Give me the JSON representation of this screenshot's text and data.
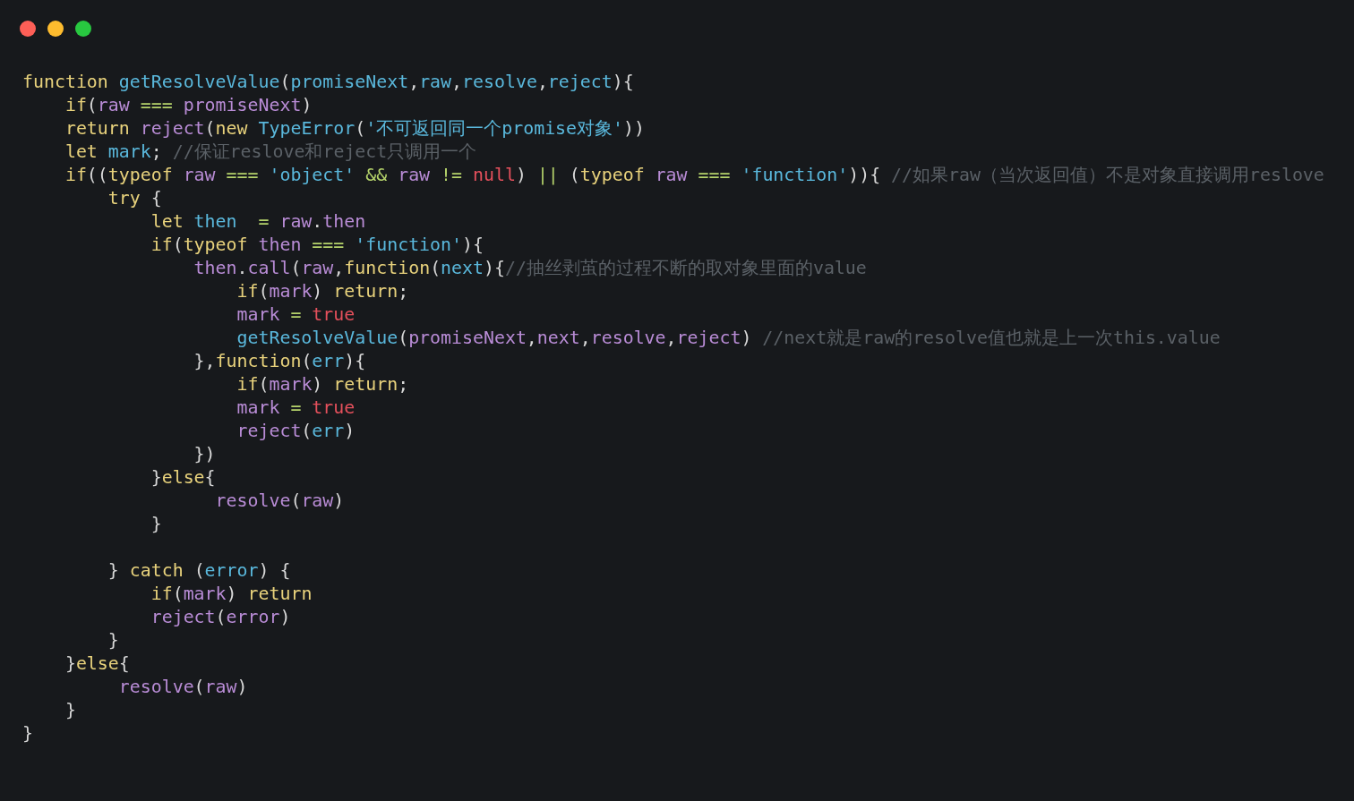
{
  "code_lines": [
    {
      "kind": "code",
      "tokens": [
        {
          "text": "function ",
          "kind": "kw"
        },
        {
          "text": "getResolveValue",
          "kind": "fn"
        },
        {
          "text": "(",
          "kind": "p"
        },
        {
          "text": "promiseNext",
          "kind": "fn"
        },
        {
          "text": ",",
          "kind": "p"
        },
        {
          "text": "raw",
          "kind": "fn"
        },
        {
          "text": ",",
          "kind": "p"
        },
        {
          "text": "resolve",
          "kind": "fn"
        },
        {
          "text": ",",
          "kind": "p"
        },
        {
          "text": "reject",
          "kind": "fn"
        },
        {
          "text": "){",
          "kind": "p"
        }
      ]
    },
    {
      "kind": "code",
      "tokens": [
        {
          "text": "    if",
          "kind": "kw"
        },
        {
          "text": "(",
          "kind": "p"
        },
        {
          "text": "raw ",
          "kind": "v"
        },
        {
          "text": "=== ",
          "kind": "op"
        },
        {
          "text": "promiseNext",
          "kind": "v"
        },
        {
          "text": ")",
          "kind": "p"
        }
      ]
    },
    {
      "kind": "code",
      "tokens": [
        {
          "text": "    return ",
          "kind": "kw"
        },
        {
          "text": "reject",
          "kind": "v"
        },
        {
          "text": "(",
          "kind": "p"
        },
        {
          "text": "new ",
          "kind": "kw"
        },
        {
          "text": "TypeError",
          "kind": "fn"
        },
        {
          "text": "(",
          "kind": "p"
        },
        {
          "text": "'不可返回同一个promise对象'",
          "kind": "str"
        },
        {
          "text": "))",
          "kind": "p"
        }
      ]
    },
    {
      "kind": "code",
      "tokens": [
        {
          "text": "    let ",
          "kind": "kw"
        },
        {
          "text": "mark",
          "kind": "fn"
        },
        {
          "text": "; ",
          "kind": "p"
        },
        {
          "text": "//保证reslove和reject只调用一个",
          "kind": "cm"
        }
      ]
    },
    {
      "kind": "code",
      "tokens": [
        {
          "text": "    if",
          "kind": "kw"
        },
        {
          "text": "((",
          "kind": "p"
        },
        {
          "text": "typeof ",
          "kind": "kw"
        },
        {
          "text": "raw ",
          "kind": "v"
        },
        {
          "text": "=== ",
          "kind": "op"
        },
        {
          "text": "'object' ",
          "kind": "str"
        },
        {
          "text": "&& ",
          "kind": "op"
        },
        {
          "text": "raw ",
          "kind": "v"
        },
        {
          "text": "!= ",
          "kind": "op"
        },
        {
          "text": "null",
          "kind": "lit"
        },
        {
          "text": ") ",
          "kind": "p"
        },
        {
          "text": "|| ",
          "kind": "op"
        },
        {
          "text": "(",
          "kind": "p"
        },
        {
          "text": "typeof ",
          "kind": "kw"
        },
        {
          "text": "raw ",
          "kind": "v"
        },
        {
          "text": "=== ",
          "kind": "op"
        },
        {
          "text": "'function'",
          "kind": "str"
        },
        {
          "text": ")){ ",
          "kind": "p"
        },
        {
          "text": "//如果raw（当次返回值）不是对象直接调用reslove",
          "kind": "cm"
        }
      ]
    },
    {
      "kind": "code",
      "tokens": [
        {
          "text": "        try ",
          "kind": "kw"
        },
        {
          "text": "{",
          "kind": "p"
        }
      ]
    },
    {
      "kind": "code",
      "tokens": [
        {
          "text": "            let ",
          "kind": "kw"
        },
        {
          "text": "then  ",
          "kind": "fn"
        },
        {
          "text": "= ",
          "kind": "op"
        },
        {
          "text": "raw",
          "kind": "v"
        },
        {
          "text": ".",
          "kind": "p"
        },
        {
          "text": "then",
          "kind": "v"
        }
      ]
    },
    {
      "kind": "code",
      "tokens": [
        {
          "text": "            if",
          "kind": "kw"
        },
        {
          "text": "(",
          "kind": "p"
        },
        {
          "text": "typeof ",
          "kind": "kw"
        },
        {
          "text": "then ",
          "kind": "v"
        },
        {
          "text": "=== ",
          "kind": "op"
        },
        {
          "text": "'function'",
          "kind": "str"
        },
        {
          "text": "){",
          "kind": "p"
        }
      ]
    },
    {
      "kind": "code",
      "tokens": [
        {
          "text": "                then",
          "kind": "v"
        },
        {
          "text": ".",
          "kind": "p"
        },
        {
          "text": "call",
          "kind": "v"
        },
        {
          "text": "(",
          "kind": "p"
        },
        {
          "text": "raw",
          "kind": "v"
        },
        {
          "text": ",",
          "kind": "p"
        },
        {
          "text": "function",
          "kind": "kw"
        },
        {
          "text": "(",
          "kind": "p"
        },
        {
          "text": "next",
          "kind": "fn"
        },
        {
          "text": "){",
          "kind": "p"
        },
        {
          "text": "//抽丝剥茧的过程不断的取对象里面的value",
          "kind": "cm"
        }
      ]
    },
    {
      "kind": "code",
      "tokens": [
        {
          "text": "                    if",
          "kind": "kw"
        },
        {
          "text": "(",
          "kind": "p"
        },
        {
          "text": "mark",
          "kind": "v"
        },
        {
          "text": ") ",
          "kind": "p"
        },
        {
          "text": "return",
          "kind": "kw"
        },
        {
          "text": ";",
          "kind": "p"
        }
      ]
    },
    {
      "kind": "code",
      "tokens": [
        {
          "text": "                    mark ",
          "kind": "v"
        },
        {
          "text": "= ",
          "kind": "op"
        },
        {
          "text": "true",
          "kind": "lit"
        }
      ]
    },
    {
      "kind": "code",
      "tokens": [
        {
          "text": "                    getResolveValue",
          "kind": "fn"
        },
        {
          "text": "(",
          "kind": "p"
        },
        {
          "text": "promiseNext",
          "kind": "v"
        },
        {
          "text": ",",
          "kind": "p"
        },
        {
          "text": "next",
          "kind": "v"
        },
        {
          "text": ",",
          "kind": "p"
        },
        {
          "text": "resolve",
          "kind": "v"
        },
        {
          "text": ",",
          "kind": "p"
        },
        {
          "text": "reject",
          "kind": "v"
        },
        {
          "text": ") ",
          "kind": "p"
        },
        {
          "text": "//next就是raw的resolve值也就是上一次this.value",
          "kind": "cm"
        }
      ]
    },
    {
      "kind": "code",
      "tokens": [
        {
          "text": "                },",
          "kind": "p"
        },
        {
          "text": "function",
          "kind": "kw"
        },
        {
          "text": "(",
          "kind": "p"
        },
        {
          "text": "err",
          "kind": "fn"
        },
        {
          "text": "){",
          "kind": "p"
        }
      ]
    },
    {
      "kind": "code",
      "tokens": [
        {
          "text": "                    if",
          "kind": "kw"
        },
        {
          "text": "(",
          "kind": "p"
        },
        {
          "text": "mark",
          "kind": "v"
        },
        {
          "text": ") ",
          "kind": "p"
        },
        {
          "text": "return",
          "kind": "kw"
        },
        {
          "text": ";",
          "kind": "p"
        }
      ]
    },
    {
      "kind": "code",
      "tokens": [
        {
          "text": "                    mark ",
          "kind": "v"
        },
        {
          "text": "= ",
          "kind": "op"
        },
        {
          "text": "true",
          "kind": "lit"
        }
      ]
    },
    {
      "kind": "code",
      "tokens": [
        {
          "text": "                    reject",
          "kind": "v"
        },
        {
          "text": "(",
          "kind": "p"
        },
        {
          "text": "err",
          "kind": "fn"
        },
        {
          "text": ")",
          "kind": "p"
        }
      ]
    },
    {
      "kind": "code",
      "tokens": [
        {
          "text": "                })",
          "kind": "p"
        }
      ]
    },
    {
      "kind": "code",
      "tokens": [
        {
          "text": "            }",
          "kind": "p"
        },
        {
          "text": "else",
          "kind": "kw"
        },
        {
          "text": "{",
          "kind": "p"
        }
      ]
    },
    {
      "kind": "code",
      "tokens": [
        {
          "text": "                  resolve",
          "kind": "v"
        },
        {
          "text": "(",
          "kind": "p"
        },
        {
          "text": "raw",
          "kind": "v"
        },
        {
          "text": ")",
          "kind": "p"
        }
      ]
    },
    {
      "kind": "code",
      "tokens": [
        {
          "text": "            }",
          "kind": "p"
        }
      ]
    },
    {
      "kind": "blank"
    },
    {
      "kind": "code",
      "tokens": [
        {
          "text": "        } ",
          "kind": "p"
        },
        {
          "text": "catch ",
          "kind": "kw"
        },
        {
          "text": "(",
          "kind": "p"
        },
        {
          "text": "error",
          "kind": "fn"
        },
        {
          "text": ") {",
          "kind": "p"
        }
      ]
    },
    {
      "kind": "code",
      "tokens": [
        {
          "text": "            if",
          "kind": "kw"
        },
        {
          "text": "(",
          "kind": "p"
        },
        {
          "text": "mark",
          "kind": "v"
        },
        {
          "text": ") ",
          "kind": "p"
        },
        {
          "text": "return",
          "kind": "kw"
        }
      ]
    },
    {
      "kind": "code",
      "tokens": [
        {
          "text": "            reject",
          "kind": "v"
        },
        {
          "text": "(",
          "kind": "p"
        },
        {
          "text": "error",
          "kind": "v"
        },
        {
          "text": ")",
          "kind": "p"
        }
      ]
    },
    {
      "kind": "code",
      "tokens": [
        {
          "text": "        }",
          "kind": "p"
        }
      ]
    },
    {
      "kind": "code",
      "tokens": [
        {
          "text": "    }",
          "kind": "p"
        },
        {
          "text": "else",
          "kind": "kw"
        },
        {
          "text": "{",
          "kind": "p"
        }
      ]
    },
    {
      "kind": "code",
      "tokens": [
        {
          "text": "         resolve",
          "kind": "v"
        },
        {
          "text": "(",
          "kind": "p"
        },
        {
          "text": "raw",
          "kind": "v"
        },
        {
          "text": ")",
          "kind": "p"
        }
      ]
    },
    {
      "kind": "code",
      "tokens": [
        {
          "text": "    }",
          "kind": "p"
        }
      ]
    },
    {
      "kind": "code",
      "tokens": [
        {
          "text": "}",
          "kind": "p"
        }
      ]
    }
  ]
}
